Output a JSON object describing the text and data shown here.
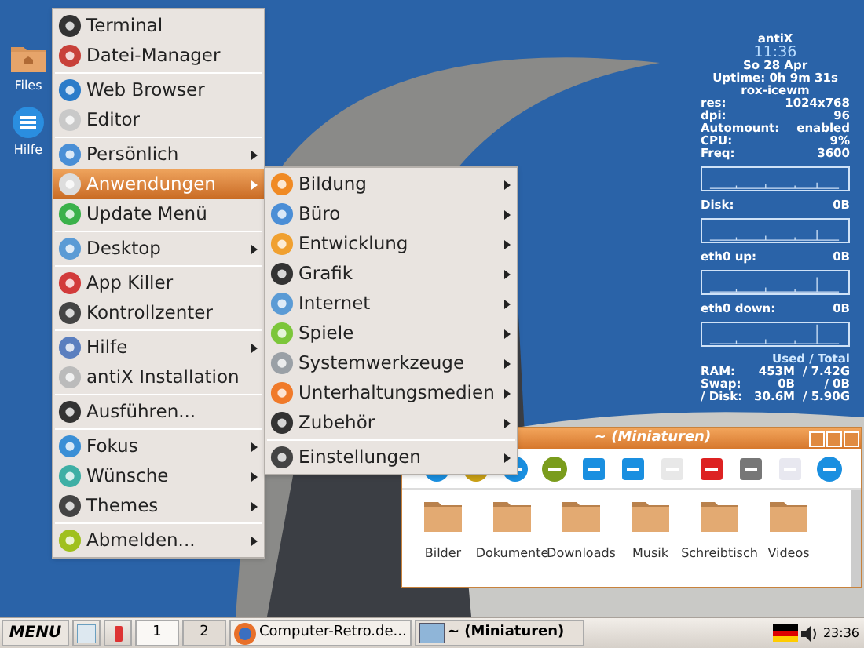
{
  "desktop_icons": [
    {
      "label": "Files",
      "kind": "folder"
    },
    {
      "label": "Hilfe",
      "kind": "help"
    }
  ],
  "menu": {
    "sections": [
      [
        {
          "label": "Terminal",
          "submenu": false,
          "selected": false
        },
        {
          "label": "Datei-Manager",
          "submenu": false,
          "selected": false
        }
      ],
      [
        {
          "label": "Web Browser",
          "submenu": false,
          "selected": false
        },
        {
          "label": "Editor",
          "submenu": false,
          "selected": false
        }
      ],
      [
        {
          "label": "Persönlich",
          "submenu": true,
          "selected": false
        },
        {
          "label": "Anwendungen",
          "submenu": true,
          "selected": true
        },
        {
          "label": "Update Menü",
          "submenu": false,
          "selected": false
        }
      ],
      [
        {
          "label": "Desktop",
          "submenu": true,
          "selected": false
        }
      ],
      [
        {
          "label": "App Killer",
          "submenu": false,
          "selected": false
        },
        {
          "label": "Kontrollzenter",
          "submenu": false,
          "selected": false
        }
      ],
      [
        {
          "label": "Hilfe",
          "submenu": true,
          "selected": false
        },
        {
          "label": "antiX Installation",
          "submenu": false,
          "selected": false
        }
      ],
      [
        {
          "label": "Ausführen...",
          "submenu": false,
          "selected": false
        }
      ],
      [
        {
          "label": "Fokus",
          "submenu": true,
          "selected": false
        },
        {
          "label": "Wünsche",
          "submenu": true,
          "selected": false
        },
        {
          "label": "Themes",
          "submenu": true,
          "selected": false
        }
      ],
      [
        {
          "label": "Abmelden...",
          "submenu": true,
          "selected": false
        }
      ]
    ]
  },
  "submenu": {
    "sections": [
      [
        {
          "label": "Bildung",
          "submenu": true,
          "selected": false
        },
        {
          "label": "Büro",
          "submenu": true,
          "selected": false
        },
        {
          "label": "Entwicklung",
          "submenu": true,
          "selected": false
        },
        {
          "label": "Grafik",
          "submenu": true,
          "selected": false
        },
        {
          "label": "Internet",
          "submenu": true,
          "selected": false
        },
        {
          "label": "Spiele",
          "submenu": true,
          "selected": false
        },
        {
          "label": "Systemwerkzeuge",
          "submenu": true,
          "selected": false
        },
        {
          "label": "Unterhaltungsmedien",
          "submenu": true,
          "selected": false
        },
        {
          "label": "Zubehör",
          "submenu": true,
          "selected": false
        }
      ],
      [
        {
          "label": "Einstellungen",
          "submenu": true,
          "selected": false
        }
      ]
    ]
  },
  "conky": {
    "host": "antiX",
    "time": "11:36",
    "date": "So 28 Apr",
    "uptime": "Uptime: 0h 9m 31s",
    "session": "rox-icewm",
    "stats": [
      {
        "label": "res:",
        "value": "1024x768"
      },
      {
        "label": "dpi:",
        "value": "96"
      },
      {
        "label": "Automount:",
        "value": "enabled"
      },
      {
        "label": "CPU:",
        "value": "9%"
      },
      {
        "label": "Freq:",
        "value": "3600"
      }
    ],
    "graphs": [
      {
        "label": "Disk:",
        "value": "0B"
      },
      {
        "label": "eth0 up:",
        "value": "0B"
      },
      {
        "label": "eth0 down:",
        "value": "0B"
      }
    ],
    "usage_header": "Used / Total",
    "usage": [
      {
        "label": "RAM:",
        "used": "453M",
        "total": "/ 7.42G"
      },
      {
        "label": "Swap:",
        "used": "0B",
        "total": "/ 0B"
      },
      {
        "label": "/ Disk:",
        "used": "30.6M",
        "total": "/ 5.90G"
      }
    ]
  },
  "file_window": {
    "title": "~ (Miniaturen)",
    "folders": [
      "Bilder",
      "Dokumente",
      "Downloads",
      "Musik",
      "Schreibtisch",
      "Videos"
    ]
  },
  "taskbar": {
    "menu_button": "MENU",
    "workspaces": [
      {
        "label": "1",
        "selected": true
      },
      {
        "label": "2",
        "selected": false
      }
    ],
    "tasks": [
      {
        "label": "Computer-Retro.de...",
        "kind": "browser",
        "selected": false
      },
      {
        "label": "~ (Miniaturen)",
        "kind": "files",
        "selected": true
      }
    ],
    "clock": "23:36"
  }
}
